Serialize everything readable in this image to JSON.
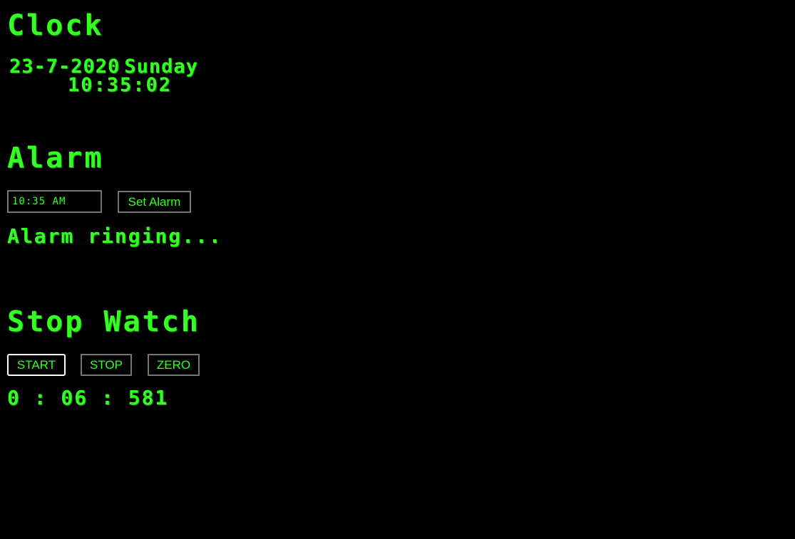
{
  "clock": {
    "heading": "Clock",
    "date": "23-7-2020",
    "day": "Sunday",
    "time": "10:35:02"
  },
  "alarm": {
    "heading": "Alarm",
    "time_value": "10:35 AM",
    "set_button_label": "Set Alarm",
    "status": "Alarm ringing..."
  },
  "stopwatch": {
    "heading": "Stop Watch",
    "start_label": "START",
    "stop_label": "STOP",
    "zero_label": "ZERO",
    "display": "0 : 06 : 581"
  },
  "colors": {
    "background": "#000000",
    "text": "#33ff22",
    "button_border": "#767676",
    "focused_border": "#ffffff"
  }
}
